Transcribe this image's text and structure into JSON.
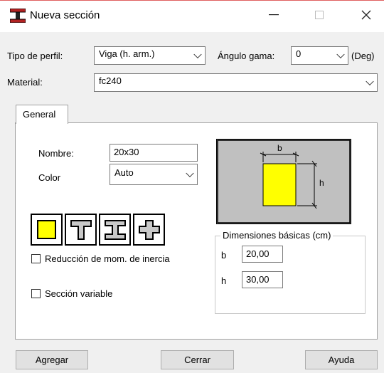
{
  "window": {
    "title": "Nueva sección"
  },
  "toolbar": {
    "profile_type_label": "Tipo de perfil:",
    "profile_type_value": "Viga (h. arm.)",
    "gamma_label": "Ángulo gama:",
    "gamma_value": "0",
    "gamma_unit": "(Deg)",
    "material_label": "Material:",
    "material_value": "fc240"
  },
  "tabs": [
    {
      "label": "General"
    }
  ],
  "general": {
    "name_label": "Nombre:",
    "name_value": "20x30",
    "color_label": "Color",
    "color_value": "Auto",
    "diagram": {
      "b_label": "b",
      "h_label": "h",
      "fill_color": "#ffff00",
      "bg_color": "#c0c0c0"
    },
    "shapes": [
      "rectangle-section-icon",
      "t-section-icon",
      "i-section-icon",
      "cross-section-icon"
    ],
    "inertia_reduction_label": "Reducción de mom. de inercia",
    "inertia_reduction_checked": false,
    "variable_section_label": "Sección variable",
    "variable_section_checked": false,
    "dimensions": {
      "title": "Dimensiones básicas (cm)",
      "b_label": "b",
      "b_value": "20,00",
      "h_label": "h",
      "h_value": "30,00"
    }
  },
  "buttons": {
    "add": "Agregar",
    "close": "Cerrar",
    "help": "Ayuda"
  }
}
